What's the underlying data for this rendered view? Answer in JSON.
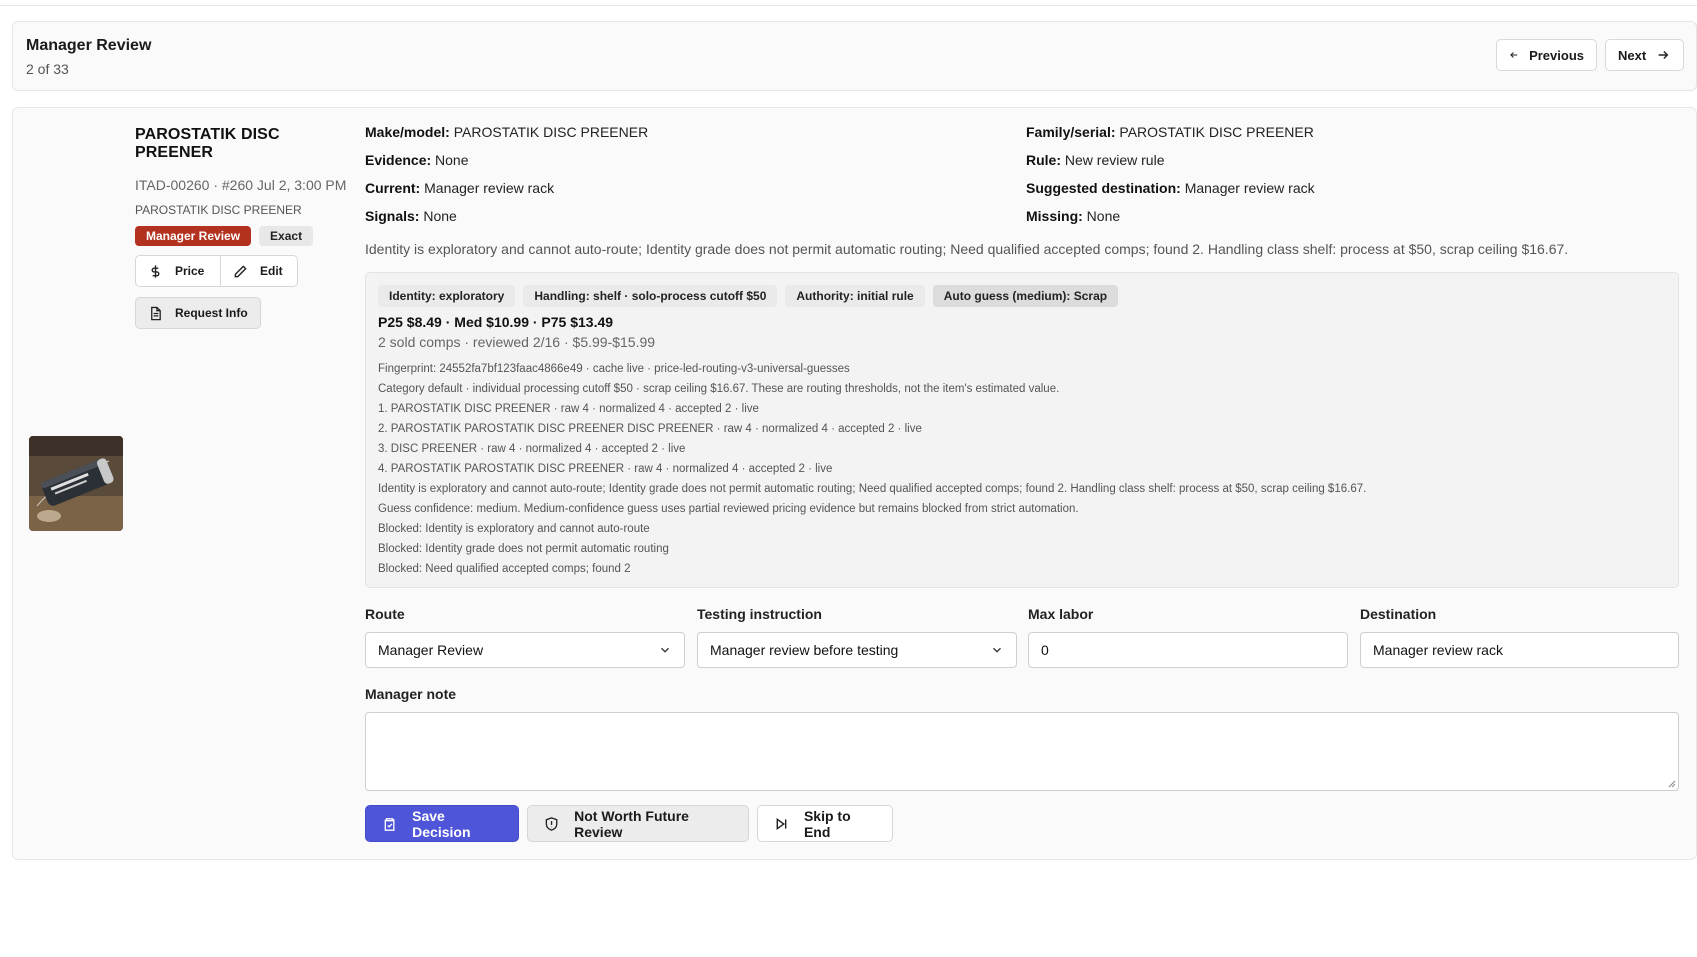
{
  "header": {
    "title": "Manager Review",
    "position": "2 of 33",
    "prev_label": "Previous",
    "next_label": "Next"
  },
  "item": {
    "title": "PAROSTATIK DISC PREENER",
    "meta": "ITAD-00260 · #260 Jul 2, 3:00 PM",
    "sub": "PAROSTATIK DISC PREENER",
    "badges": [
      "Manager Review",
      "Exact"
    ],
    "buttons": {
      "price": "Price",
      "edit": "Edit",
      "request": "Request Info"
    }
  },
  "info": {
    "make_model": {
      "label": "Make/model:",
      "value": "PAROSTATIK DISC PREENER"
    },
    "family_serial": {
      "label": "Family/serial:",
      "value": "PAROSTATIK DISC PREENER"
    },
    "evidence": {
      "label": "Evidence:",
      "value": "None"
    },
    "rule": {
      "label": "Rule:",
      "value": "New review rule"
    },
    "current": {
      "label": "Current:",
      "value": "Manager review rack"
    },
    "suggested": {
      "label": "Suggested destination:",
      "value": "Manager review rack"
    },
    "signals": {
      "label": "Signals:",
      "value": "None"
    },
    "missing": {
      "label": "Missing:",
      "value": "None"
    },
    "summary": "Identity is exploratory and cannot auto-route; Identity grade does not permit automatic routing; Need qualified accepted comps; found 2. Handling class shelf: process at $50, scrap ceiling $16.67."
  },
  "details": {
    "tags": [
      "Identity: exploratory",
      "Handling: shelf · solo-process cutoff $50",
      "Authority: initial rule",
      "Auto guess (medium): Scrap"
    ],
    "prices": "P25 $8.49 · Med $10.99 · P75 $13.49",
    "comps": "2 sold comps · reviewed 2/16 · $5.99-$15.99",
    "lines": [
      "Fingerprint: 24552fa7bf123faac4866e49 · cache live · price-led-routing-v3-universal-guesses",
      "Category default · individual processing cutoff $50 · scrap ceiling $16.67. These are routing thresholds, not the item's estimated value.",
      "1. PAROSTATIK DISC PREENER · raw 4 · normalized 4 · accepted 2 · live",
      "2. PAROSTATIK PAROSTATIK DISC PREENER DISC PREENER · raw 4 · normalized 4 · accepted 2 · live",
      "3. DISC PREENER · raw 4 · normalized 4 · accepted 2 · live",
      "4. PAROSTATIK PAROSTATIK DISC PREENER · raw 4 · normalized 4 · accepted 2 · live",
      "Identity is exploratory and cannot auto-route; Identity grade does not permit automatic routing; Need qualified accepted comps; found 2. Handling class shelf: process at $50, scrap ceiling $16.67.",
      "Guess confidence: medium. Medium-confidence guess uses partial reviewed pricing evidence but remains blocked from strict automation.",
      "Blocked: Identity is exploratory and cannot auto-route",
      "Blocked: Identity grade does not permit automatic routing",
      "Blocked: Need qualified accepted comps; found 2"
    ]
  },
  "form": {
    "route": {
      "label": "Route",
      "value": "Manager Review"
    },
    "testing": {
      "label": "Testing instruction",
      "value": "Manager review before testing"
    },
    "max_labor": {
      "label": "Max labor",
      "value": "0"
    },
    "destination": {
      "label": "Destination",
      "value": "Manager review rack"
    },
    "note": {
      "label": "Manager note",
      "value": ""
    }
  },
  "actions": {
    "save": "Save Decision",
    "not_worth": "Not Worth Future Review",
    "skip": "Skip to End"
  }
}
